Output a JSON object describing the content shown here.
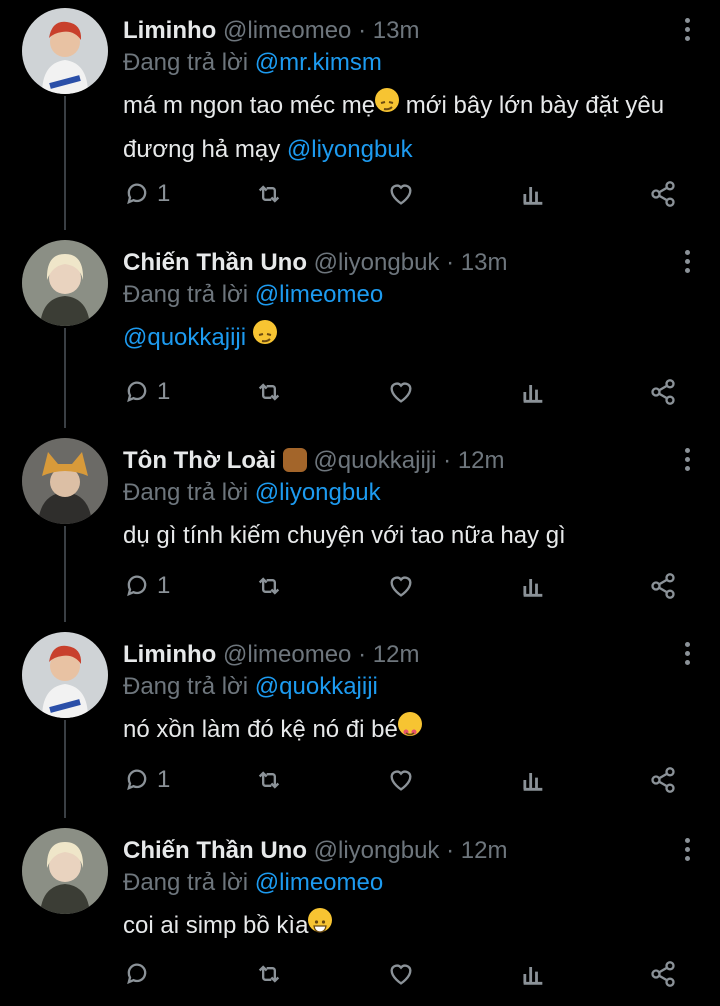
{
  "tweets": [
    {
      "name": "Liminho",
      "handle": "@limeomeo",
      "time": "13m",
      "reply_prefix": "Đang trả lời",
      "reply_to": "@mr.kimsm",
      "text_line1": "má m ngon tao méc mẹ",
      "emoji1": "smirking-face",
      "text_line1_after": " mới bây lớn bày đặt yêu",
      "text_line2": "đương hả mạy ",
      "text_mention": "@liyongbuk",
      "reply_count": "1"
    },
    {
      "name": "Chiến Thần Uno",
      "handle": "@liyongbuk",
      "time": "13m",
      "reply_prefix": "Đang trả lời",
      "reply_to": "@limeomeo",
      "text_mention": "@quokkajiji",
      "emoji1": "smirking-face",
      "reply_count": "1"
    },
    {
      "name": "Tôn Thờ Loài",
      "name_emoji": "squirrel",
      "handle": "@quokkajiji",
      "time": "12m",
      "reply_prefix": "Đang trả lời",
      "reply_to": "@liyongbuk",
      "text": "dụ gì tính kiếm chuyện với tao nữa hay gì",
      "reply_count": "1"
    },
    {
      "name": "Liminho",
      "handle": "@limeomeo",
      "time": "12m",
      "reply_prefix": "Đang trả lời",
      "reply_to": "@quokkajiji",
      "text": "nó xồn làm đó kệ nó đi bé",
      "emoji1": "smiling-face-with-hearts",
      "reply_count": "1"
    },
    {
      "name": "Chiến Thần Uno",
      "handle": "@liyongbuk",
      "time": "12m",
      "reply_prefix": "Đang trả lời",
      "reply_to": "@limeomeo",
      "text": "coi ai simp bồ kìa",
      "emoji1": "grinning-face",
      "reply_count": ""
    }
  ],
  "colors": {
    "background": "#000000",
    "accent": "#1d9bf0",
    "muted": "#6e767d",
    "text": "#e7e9ea"
  }
}
